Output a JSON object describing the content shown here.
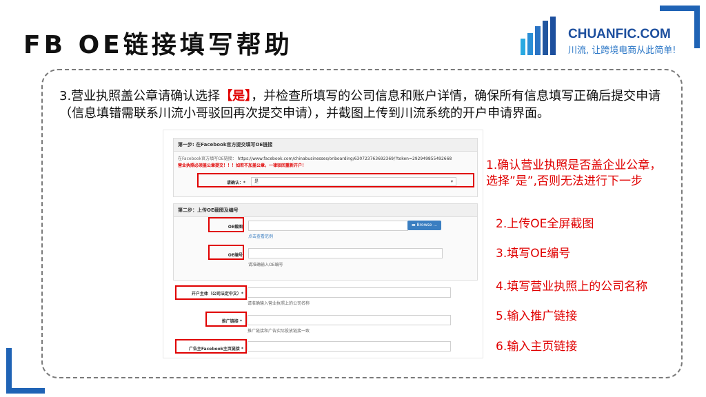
{
  "title": "FB OE链接填写帮助",
  "logo": {
    "name": "CHUANFIC.COM",
    "slogan": "川流, 让跨境电商从此简单!"
  },
  "intro": {
    "before": "3.营业执照盖公章请确认选择",
    "highlight": "【是】",
    "after": "，并检查所填写的公司信息和账户详情，确保所有信息填写正确后提交申请（信息填错需联系川流小哥驳回再次提交申请），并截图上传到川流系统的开户申请界面。"
  },
  "form": {
    "step1": {
      "title": "第一步: 在Facebook官方提交填写OE链接",
      "oe_prefix": "在Facebook官方填写OE链接：",
      "oe_link": "https://www.facebook.com/chinabusinesses/onboarding/630723763692369/?token=292949855492668",
      "warning": "营业执照必须盖公章提交！！！如若不加盖公章，一律驳回重新开户！",
      "confirm_label": "请确认：*",
      "confirm_value": "是"
    },
    "step2": {
      "title": "第二步：上传OE截图及编号",
      "screenshot_label": "OE截图",
      "browse_label": "Browse ...",
      "example_link": "点击查看范例",
      "oe_number_label": "OE编号",
      "oe_number_hint": "请准确输入OE编号"
    },
    "company_label": "开户主体（公司法定中文）*",
    "company_hint": "请准确输入营业执照上的公司名称",
    "promo_label": "推广链接 *",
    "promo_hint": "推广链接和广告实际投放链接一致",
    "homepage_label": "广告主Facebook主页链接 *"
  },
  "notes": [
    "1.确认营业执照是否盖企业公章，选择”是”,否则无法进行下一步",
    "2.上传OE全屏截图",
    "3.填写OE编号",
    "4.填写营业执照上的公司名称",
    "5.输入推广链接",
    "6.输入主页链接"
  ],
  "colors": {
    "accent_blue": "#1f63b5",
    "highlight_red": "#e00000",
    "logo_blue": "#1d4f9e"
  }
}
